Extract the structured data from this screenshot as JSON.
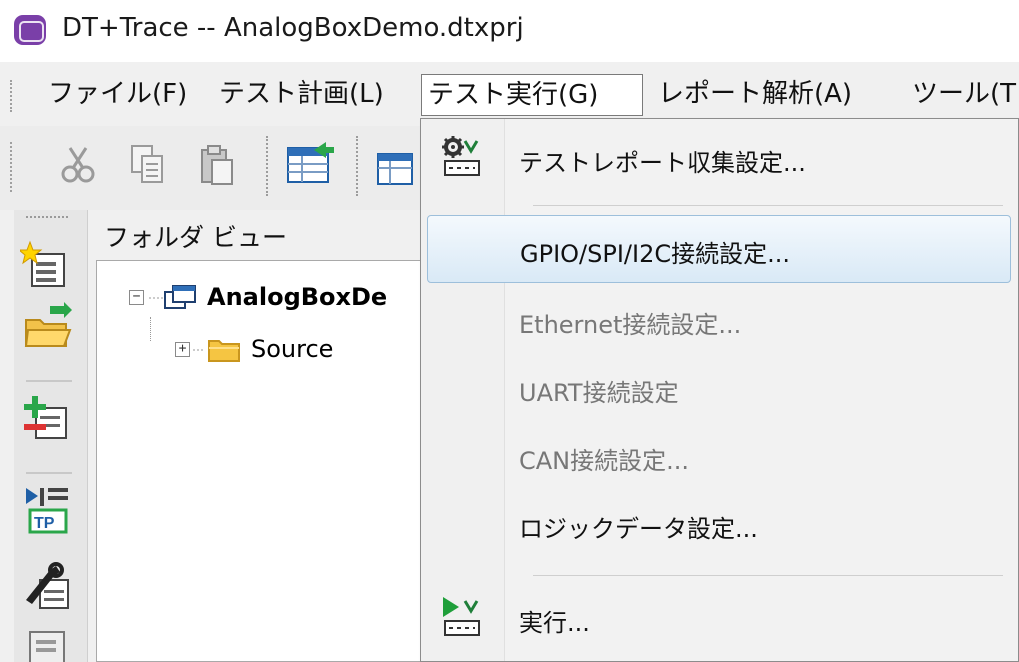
{
  "window": {
    "title": "DT+Trace -- AnalogBoxDemo.dtxprj",
    "accent": "#7a3fa8"
  },
  "menubar": {
    "items": [
      {
        "label": "ファイル(F)"
      },
      {
        "label": "テスト計画(L)"
      },
      {
        "label": "テスト実行(G)"
      },
      {
        "label": "レポート解析(A)"
      },
      {
        "label": "ツール(T"
      }
    ]
  },
  "toolbar": {
    "icons": [
      "cut-icon",
      "copy-icon",
      "paste-icon",
      "import-table-icon",
      "table-icon"
    ]
  },
  "vtoolbar": {
    "icons": [
      "new-project-icon",
      "open-folder-icon",
      "add-item-icon",
      "test-point-icon",
      "tools-icon",
      "report-icon"
    ]
  },
  "folder_view": {
    "title": "フォルダ ビュー",
    "tree": [
      {
        "label": "AnalogBoxDe",
        "expander": "−",
        "icon": "project-icon"
      },
      {
        "label": "Source",
        "expander": "+",
        "icon": "folder-icon"
      }
    ]
  },
  "dropdown": {
    "items": [
      {
        "label": "テストレポート収集設定...",
        "enabled": true,
        "icon": "gear-collect-icon"
      },
      {
        "label": "GPIO/SPI/I2C接続設定...",
        "enabled": true,
        "highlighted": true
      },
      {
        "label": "Ethernet接続設定...",
        "enabled": false
      },
      {
        "label": "UART接続設定",
        "enabled": false
      },
      {
        "label": "CAN接続設定...",
        "enabled": false
      },
      {
        "label": "ロジックデータ設定...",
        "enabled": true
      },
      {
        "label": "実行...",
        "enabled": true,
        "icon": "run-icon"
      }
    ],
    "highlight_color": "#d9e9f6"
  }
}
